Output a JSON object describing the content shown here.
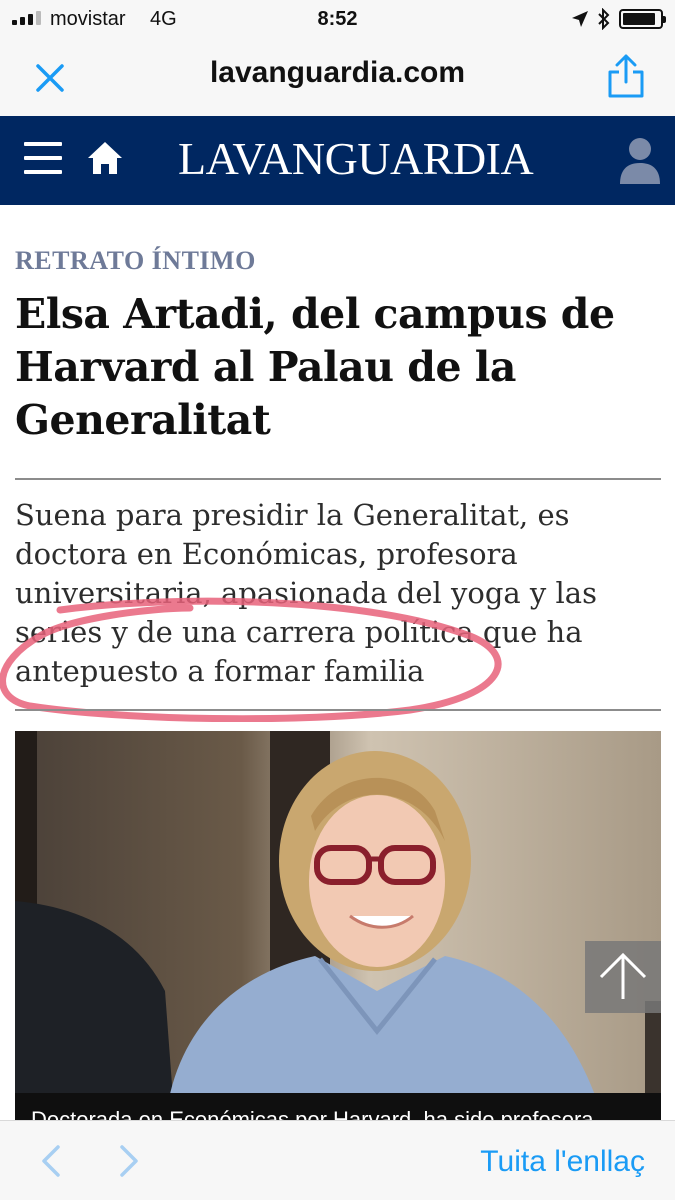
{
  "status_bar": {
    "carrier": "movistar",
    "network": "4G",
    "time": "8:52",
    "battery_level": 0.9
  },
  "browser": {
    "url_title": "lavanguardia.com",
    "close_icon": "close-icon",
    "share_icon": "share-icon"
  },
  "site": {
    "logo": "LAVANGUARDIA",
    "menu_icon": "hamburger-menu-icon",
    "home_icon": "home-icon",
    "user_icon": "user-icon"
  },
  "article": {
    "kicker": "RETRATO ÍNTIMO",
    "headline": "Elsa Artadi, del campus de Harvard al Palau de la Generalitat",
    "standfirst": "Suena para presidir la Generalitat, es doctora en Económicas, profesora universitaria, apasionada del yoga y las series y de una carrera política que ha antepuesto a formar familia",
    "photo_caption": "Doctorada en Económicas por Harvard, ha sido profesora",
    "highlight_color": "#e8627a"
  },
  "toolbar": {
    "back_icon": "chevron-left-icon",
    "forward_icon": "chevron-right-icon",
    "tweet_label": "Tuita l'enllaç"
  },
  "colors": {
    "brand_navy": "#002761",
    "kicker": "#6e7a98",
    "link_blue": "#1a9bf5"
  }
}
